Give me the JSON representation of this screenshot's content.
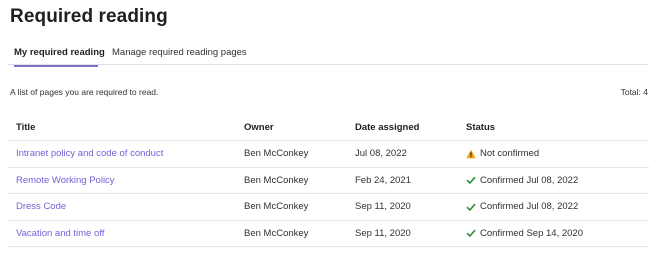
{
  "header": {
    "title": "Required reading"
  },
  "tabs": [
    {
      "label": "My required reading",
      "active": true
    },
    {
      "label": "Manage required reading pages",
      "active": false
    }
  ],
  "summary": {
    "description": "A list of pages you are required to read.",
    "total": "Total: 4"
  },
  "table": {
    "columns": [
      "Title",
      "Owner",
      "Date assigned",
      "Status"
    ],
    "rows": [
      {
        "title": "Intranet policy and code of conduct",
        "owner": "Ben McConkey",
        "date": "Jul 08, 2022",
        "status": "Not confirmed",
        "status_icon": "warning-icon"
      },
      {
        "title": "Remote Working Policy",
        "owner": "Ben McConkey",
        "date": "Feb 24, 2021",
        "status": "Confirmed Jul 08, 2022",
        "status_icon": "checkmark-icon"
      },
      {
        "title": "Dress Code",
        "owner": "Ben McConkey",
        "date": "Sep 11, 2020",
        "status": "Confirmed Jul 08, 2022",
        "status_icon": "checkmark-icon"
      },
      {
        "title": "Vacation and time off",
        "owner": "Ben McConkey",
        "date": "Sep 11, 2020",
        "status": "Confirmed Sep 14, 2020",
        "status_icon": "checkmark-icon"
      }
    ]
  },
  "colors": {
    "accent": "#7b72c9",
    "link": "#6f63d9",
    "warning": "#f0a30a",
    "success": "#2e8b3a"
  }
}
